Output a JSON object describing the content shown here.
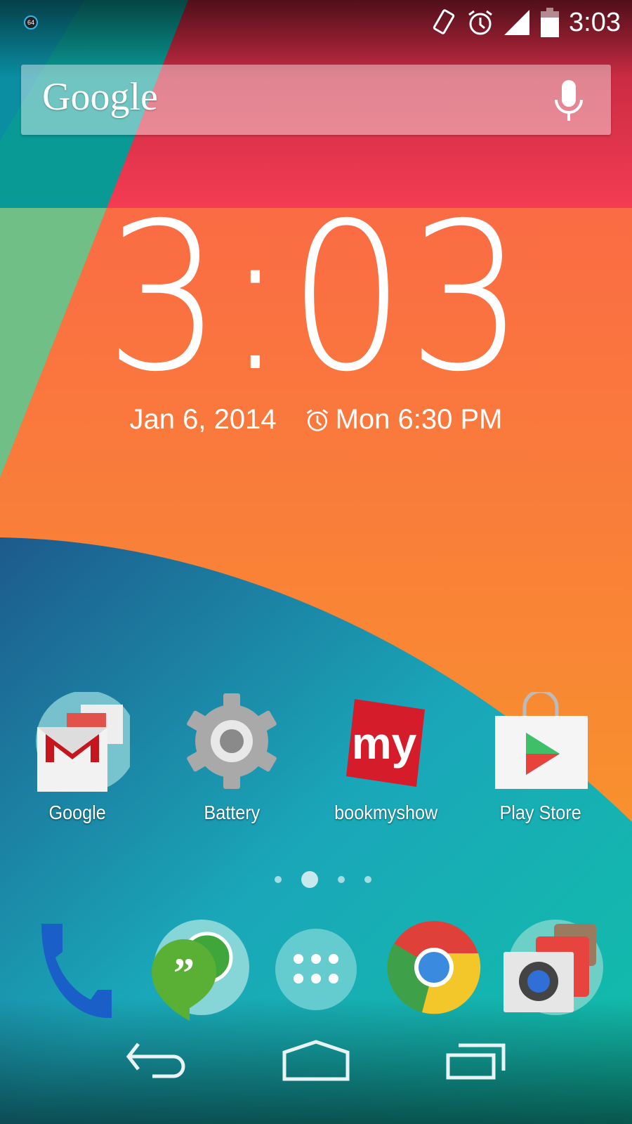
{
  "status_bar": {
    "notification_badge": "64",
    "icons": [
      "vibrate-icon",
      "alarm-icon",
      "signal-icon",
      "battery-icon"
    ],
    "time": "3:03"
  },
  "search": {
    "logo": "Google",
    "mic_icon": "microphone-icon"
  },
  "clock_widget": {
    "time": "3:03",
    "date": "Jan 6, 2014",
    "alarm": "Mon 6:30 PM"
  },
  "apps": [
    {
      "label": "Google"
    },
    {
      "label": "Battery"
    },
    {
      "label": "bookmyshow"
    },
    {
      "label": "Play Store"
    }
  ],
  "page_indicator": {
    "pages": 4,
    "current": 2
  },
  "dock": [
    "phone-icon",
    "hangouts-icon",
    "app-drawer-icon",
    "chrome-icon",
    "camera-folder-icon"
  ],
  "nav": [
    "back-icon",
    "home-icon",
    "recents-icon"
  ],
  "colors": {
    "red": "#e8344a",
    "orange": "#f7892f",
    "teal": "#17b8b6",
    "blue": "#1f5f8f"
  }
}
